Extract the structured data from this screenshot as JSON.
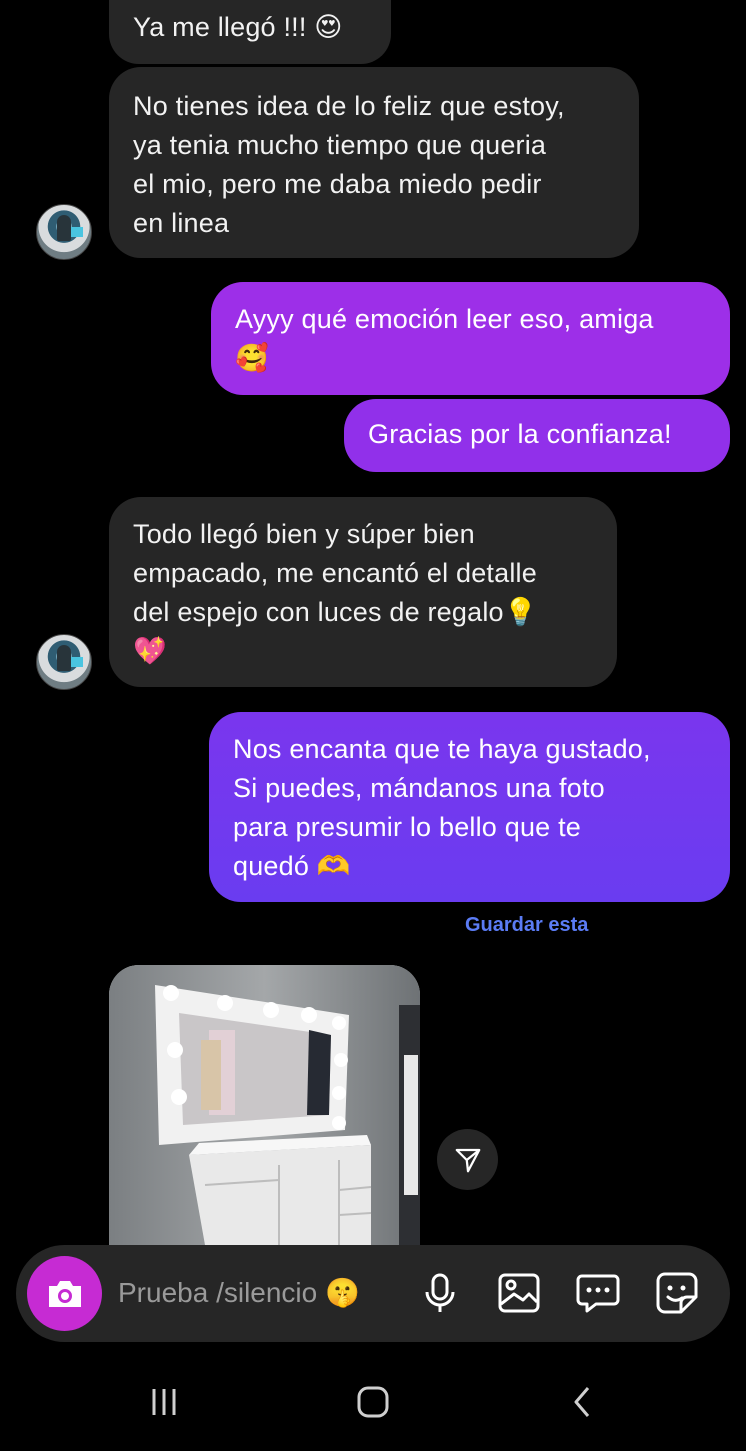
{
  "messages": [
    {
      "side": "in",
      "text": "Ya me llegó !!! 😍"
    },
    {
      "side": "in",
      "text": "No tienes idea de lo feliz que estoy,\nya tenia mucho tiempo que queria\nel mio, pero me daba miedo pedir\nen linea"
    },
    {
      "side": "out",
      "text": "Ayyy qué emoción leer eso, amiga\n🥰"
    },
    {
      "side": "out",
      "text": "Gracias por la confianza!"
    },
    {
      "side": "in",
      "text": "Todo llegó bien y súper bien\nempacado, me encantó el detalle\ndel espejo con luces de regalo💡\n💖"
    },
    {
      "side": "out",
      "text": "Nos encanta que te haya gustado,\nSi puedes, mándanos una foto\npara presumir lo bello que te\nquedó 🫶"
    }
  ],
  "save_link": "Guardar esta",
  "composer": {
    "placeholder": "Prueba /silencio 🤫",
    "camera_icon": "camera-icon",
    "mic_icon": "microphone-icon",
    "gallery_icon": "gallery-icon",
    "quick_reply_icon": "quick-reply-icon",
    "sticker_icon": "sticker-icon"
  },
  "colors": {
    "incoming_bubble": "#262626",
    "outgoing_purple": "#9d2fe8",
    "outgoing_indigo": "#6a3cf0",
    "camera_button": "#c62bd3",
    "link": "#5b7cf5"
  },
  "nav": [
    "recent-apps-icon",
    "home-icon",
    "back-icon"
  ]
}
